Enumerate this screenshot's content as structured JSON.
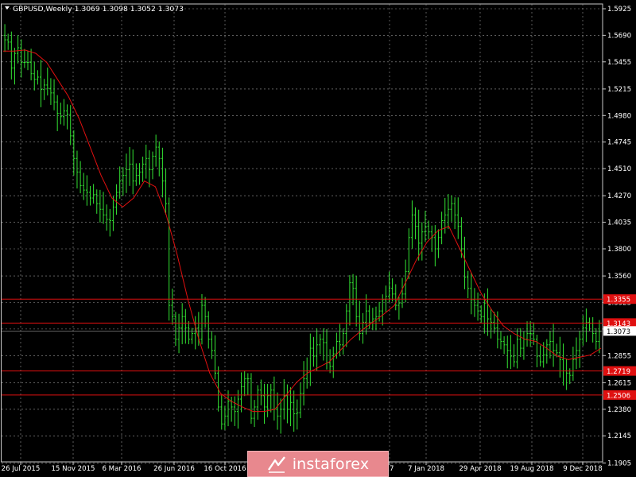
{
  "chart_data": {
    "type": "candlestick",
    "symbol": "GBPUSD,Weekly",
    "header_values": "1.3069 1.3098 1.3052 1.3073",
    "ylim": [
      1.19,
      1.5925
    ],
    "y_ticks": [
      "1.5925",
      "1.5690",
      "1.5455",
      "1.5215",
      "1.4980",
      "1.4745",
      "1.4510",
      "1.4270",
      "1.4035",
      "1.3800",
      "1.3560",
      "1.3325",
      "1.3090",
      "1.2855",
      "1.2615",
      "1.2380",
      "1.2145",
      "1.1905"
    ],
    "x_labels": [
      "26 Jul 2015",
      "15 Nov 2015",
      "6 Mar 2016",
      "26 Jun 2016",
      "16 Oct 2016",
      "17",
      "7 Jan 2018",
      "29 Apr 2018",
      "19 Aug 2018",
      "9 Dec 2018"
    ],
    "levels": [
      {
        "label": "1.3355",
        "value": 1.3355
      },
      {
        "label": "1.3143",
        "value": 1.3143
      },
      {
        "label": "1.2719",
        "value": 1.2719
      },
      {
        "label": "1.2506",
        "value": 1.2506
      }
    ],
    "current_price": {
      "label": "1.3073",
      "value": 1.3073
    },
    "close_path": [
      1.565,
      1.563,
      1.54,
      1.553,
      1.558,
      1.545,
      1.545,
      1.545,
      1.535,
      1.53,
      1.532,
      1.521,
      1.525,
      1.522,
      1.518,
      1.51,
      1.5,
      1.497,
      1.502,
      1.499,
      1.48,
      1.46,
      1.448,
      1.436,
      1.432,
      1.43,
      1.425,
      1.428,
      1.42,
      1.415,
      1.41,
      1.406,
      1.405,
      1.417,
      1.43,
      1.44,
      1.445,
      1.45,
      1.455,
      1.44,
      1.445,
      1.448,
      1.455,
      1.46,
      1.45,
      1.462,
      1.47,
      1.46,
      1.44,
      1.42,
      1.33,
      1.32,
      1.3,
      1.31,
      1.32,
      1.31,
      1.3,
      1.305,
      1.31,
      1.3,
      1.33,
      1.32,
      1.3,
      1.29,
      1.27,
      1.24,
      1.225,
      1.232,
      1.245,
      1.24,
      1.236,
      1.247,
      1.258,
      1.265,
      1.265,
      1.23,
      1.24,
      1.255,
      1.25,
      1.24,
      1.25,
      1.255,
      1.238,
      1.232,
      1.238,
      1.25,
      1.238,
      1.244,
      1.234,
      1.235,
      1.252,
      1.265,
      1.272,
      1.292,
      1.285,
      1.295,
      1.3,
      1.297,
      1.279,
      1.276,
      1.287,
      1.298,
      1.295,
      1.305,
      1.325,
      1.35,
      1.345,
      1.32,
      1.305,
      1.315,
      1.325,
      1.315,
      1.318,
      1.32,
      1.325,
      1.335,
      1.338,
      1.345,
      1.34,
      1.33,
      1.332,
      1.34,
      1.36,
      1.39,
      1.41,
      1.4,
      1.385,
      1.395,
      1.4,
      1.395,
      1.39,
      1.38,
      1.39,
      1.405,
      1.41,
      1.415,
      1.42,
      1.41,
      1.4,
      1.38,
      1.355,
      1.345,
      1.335,
      1.33,
      1.325,
      1.32,
      1.332,
      1.318,
      1.315,
      1.31,
      1.3,
      1.298,
      1.295,
      1.29,
      1.285,
      1.28,
      1.3,
      1.292,
      1.3,
      1.305,
      1.305,
      1.3,
      1.285,
      1.28,
      1.286,
      1.295,
      1.298,
      1.29,
      1.288,
      1.282,
      1.272,
      1.27,
      1.268,
      1.282,
      1.29,
      1.3,
      1.31,
      1.315,
      1.314,
      1.305,
      1.298,
      1.307
    ],
    "ma_path": [
      1.555,
      1.555,
      1.556,
      1.553,
      1.545,
      1.53,
      1.515,
      1.495,
      1.47,
      1.445,
      1.425,
      1.417,
      1.425,
      1.44,
      1.435,
      1.41,
      1.375,
      1.335,
      1.3,
      1.27,
      1.252,
      1.245,
      1.24,
      1.236,
      1.236,
      1.238,
      1.25,
      1.262,
      1.27,
      1.275,
      1.28,
      1.29,
      1.3,
      1.308,
      1.315,
      1.322,
      1.33,
      1.35,
      1.37,
      1.386,
      1.396,
      1.4,
      1.38,
      1.36,
      1.34,
      1.325,
      1.312,
      1.305,
      1.3,
      1.298,
      1.292,
      1.285,
      1.282,
      1.284,
      1.286,
      1.292
    ]
  },
  "logo": {
    "text": "instaforex"
  }
}
